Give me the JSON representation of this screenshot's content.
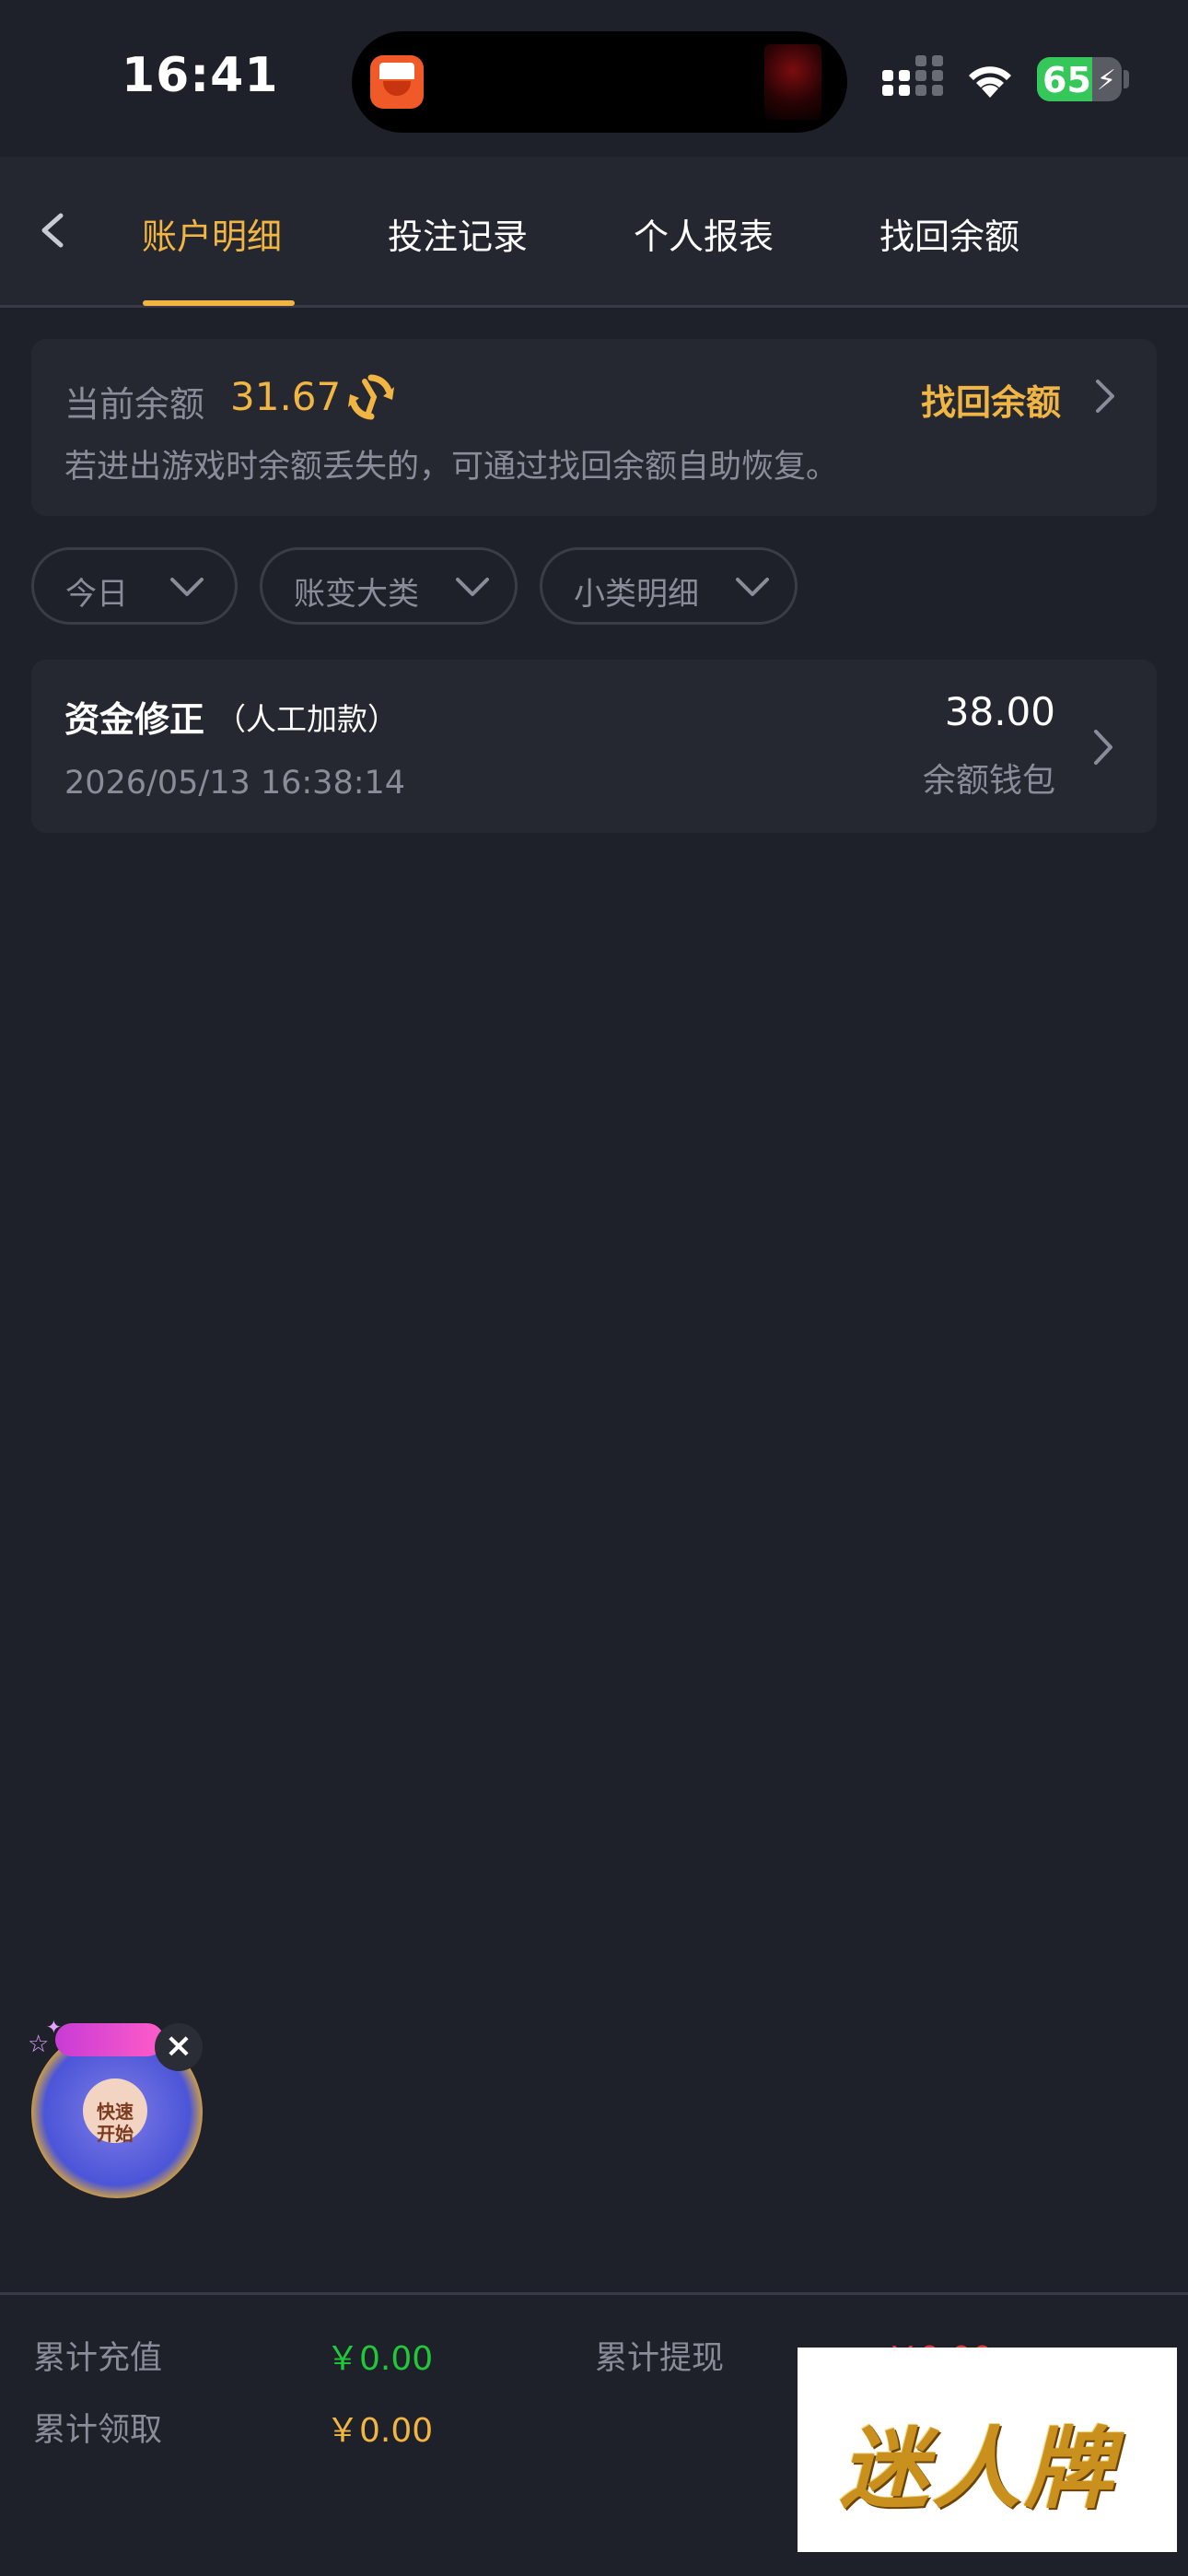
{
  "status_bar": {
    "time": "16:41",
    "battery": "65",
    "battery_level_percent": 65,
    "icons": [
      "cellular-signal-icon",
      "wifi-icon",
      "battery-charging-icon"
    ]
  },
  "nav": {
    "tabs": [
      {
        "label": "账户明细",
        "active": true
      },
      {
        "label": "投注记录",
        "active": false
      },
      {
        "label": "个人报表",
        "active": false
      },
      {
        "label": "找回余额",
        "active": false
      }
    ]
  },
  "balance": {
    "label": "当前余额",
    "value": "31.67",
    "recover_label": "找回余额",
    "note": "若进出游戏时余额丢失的，可通过找回余额自助恢复。"
  },
  "filters": [
    {
      "label": "今日"
    },
    {
      "label": "账变大类"
    },
    {
      "label": "小类明细"
    }
  ],
  "records": [
    {
      "title": "资金修正",
      "subtitle": "（人工加款）",
      "time": "2026/05/13 16:38:14",
      "amount": "38.00",
      "wallet": "余额钱包"
    }
  ],
  "widget": {
    "text": "快速开始"
  },
  "summary": {
    "recharge_label": "累计充值",
    "recharge_value": "￥0.00",
    "withdraw_label": "累计提现",
    "withdraw_value": "￥0.00",
    "claim_label": "累计领取",
    "claim_value": "￥0.00"
  },
  "watermark": {
    "text": "迷人牌"
  },
  "colors": {
    "background": "#1f212a",
    "card": "#262831",
    "accent_gold": "#f1b544",
    "muted_text": "#8a8d99",
    "green": "#21c93a",
    "red": "#e13b3b"
  }
}
